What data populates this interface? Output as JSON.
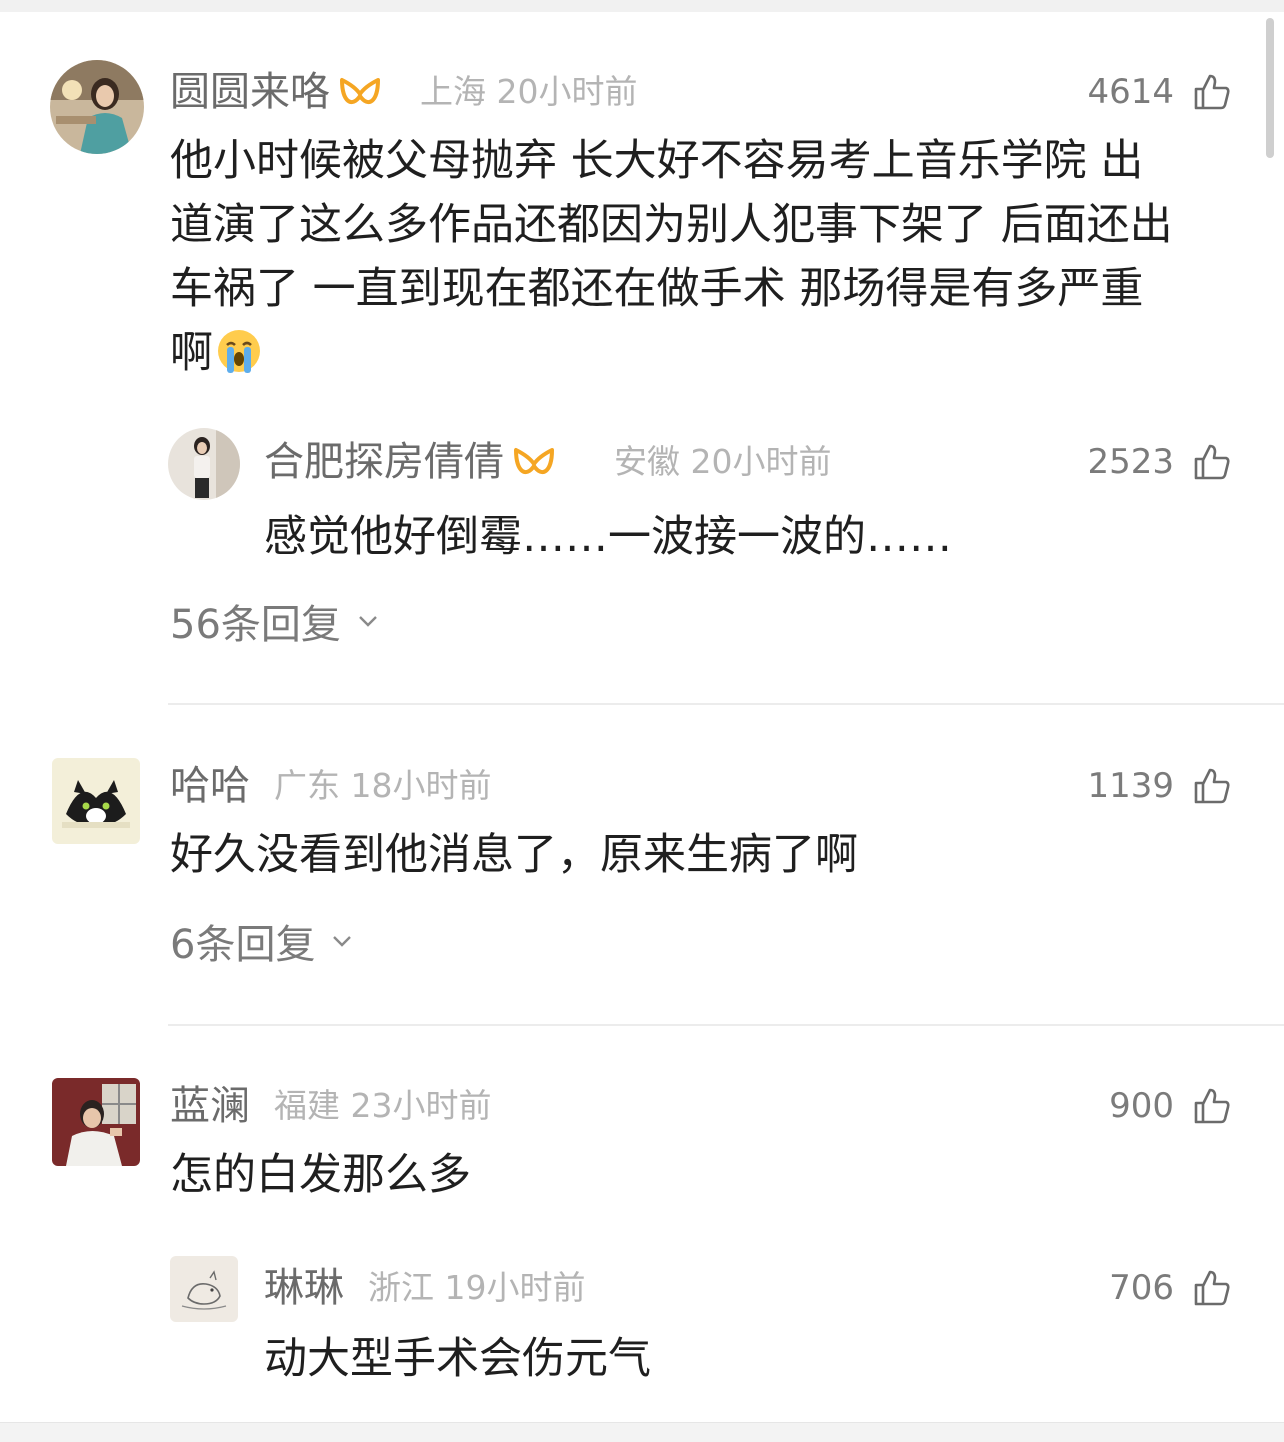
{
  "comments": [
    {
      "name": "圆圆来咯",
      "location": "上海",
      "time": "20小时前",
      "likes": "4614",
      "text_lines": [
        "他小时候被父母抛弃 长大好不容易考上音乐学院 出",
        "道演了这么多作品还都因为别人犯事下架了 后面还出",
        "车祸了 一直到现在都还在做手术 那场得是有多严重",
        "啊"
      ],
      "emoji": "loudly-crying-face-icon",
      "vip": true,
      "reply": {
        "name": "合肥探房倩倩",
        "location": "安徽",
        "time": "20小时前",
        "likes": "2523",
        "text": "感觉他好倒霉……一波接一波的……",
        "vip": true
      },
      "replies_label": "56条回复"
    },
    {
      "name": "哈哈",
      "location": "广东",
      "time": "18小时前",
      "likes": "1139",
      "text": "好久没看到他消息了，原来生病了啊",
      "replies_label": "6条回复"
    },
    {
      "name": "蓝澜",
      "location": "福建",
      "time": "23小时前",
      "likes": "900",
      "text": "怎的白发那么多",
      "reply": {
        "name": "琳琳",
        "location": "浙江",
        "time": "19小时前",
        "likes": "706",
        "text": "动大型手术会伤元气"
      }
    }
  ],
  "colors": {
    "vip_orange": "#f5a623",
    "name_gray": "#6b6b6b",
    "meta_gray": "#b4b4b4"
  }
}
